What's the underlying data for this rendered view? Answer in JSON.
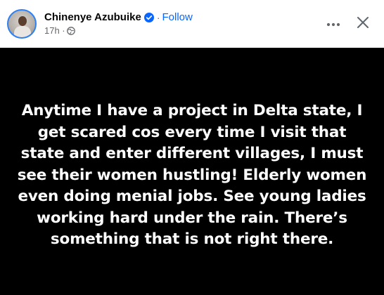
{
  "header": {
    "author_name": "Chinenye Azubuike",
    "separator": "·",
    "follow_label": "Follow",
    "timestamp": "17h ·",
    "accent_color": "#0866ff"
  },
  "icons": {
    "verified": "verified-badge-icon",
    "audience": "globe-icon",
    "more": "more-options-icon",
    "close": "close-icon"
  },
  "post": {
    "text": "Anytime I have a project in Delta state, I get scared cos every time I visit that state and enter different villages, I must see their women hustling! Elderly women even doing menial jobs. See young ladies working hard under the rain. There’s something that is not right there.",
    "background_color": "#000000",
    "text_color": "#ffffff"
  }
}
